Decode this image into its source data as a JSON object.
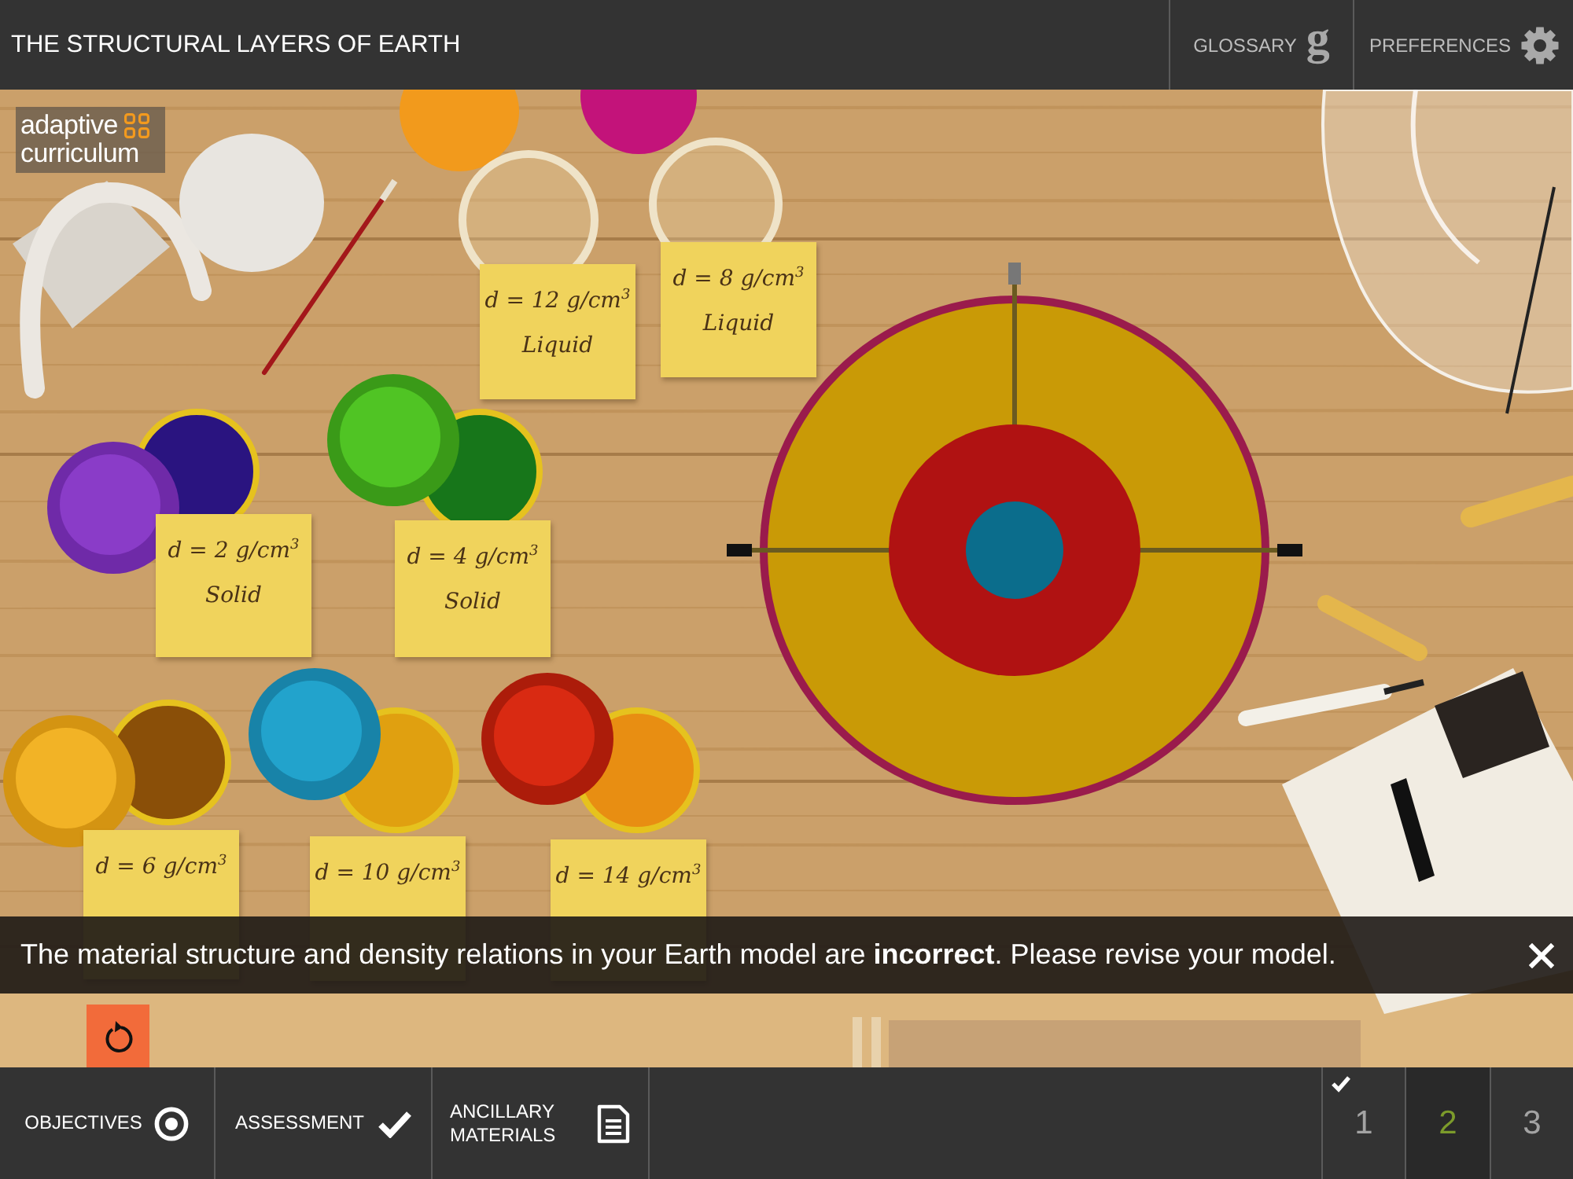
{
  "header": {
    "title": "THE STRUCTURAL LAYERS OF EARTH",
    "buttons": [
      {
        "kind": "glossary",
        "label": "GLOSSARY",
        "glyph": "g"
      },
      {
        "kind": "settings",
        "label": "PREFERENCES"
      }
    ]
  },
  "logo": {
    "lines": [
      "adaptive",
      "curriculum"
    ]
  },
  "scene": {
    "notes": [
      {
        "density": "d = 12 g/cm$^{3}$",
        "state": "Liquid"
      },
      {
        "density": "d = 8 g/cm$^{3}$",
        "state": "Liquid"
      },
      {
        "density": "d = 2 g/cm$^{3}$",
        "state": "Solid"
      },
      {
        "density": "d = 4 g/cm$^{3}$",
        "state": "Solid"
      },
      {
        "density": "d = 6 g/cm$^{3}$"
      },
      {
        "density": "d = 10 g/cm$^{3}$"
      },
      {
        "density": "d = 14 g/cm$^{3}$"
      }
    ],
    "earth_model": {
      "layers": [
        {
          "color": "#0b6d8c"
        },
        {
          "color": "#b01212"
        },
        {
          "color": "#c99a06"
        },
        {
          "color": "#9a1b4c"
        }
      ]
    }
  },
  "feedback": {
    "message": "The material structure and density relations in your Earth model are **incorrect**. Please revise your model."
  },
  "footer": {
    "sections": [
      {
        "kind": "target",
        "label": "OBJECTIVES"
      },
      {
        "kind": "check",
        "label": "ASSESSMENT"
      },
      {
        "kind": "document",
        "label": "ANCILLARY MATERIALS"
      }
    ],
    "pages": [
      {
        "label": "1",
        "selected": false,
        "completed": true
      },
      {
        "label": "2",
        "selected": true,
        "completed": false
      },
      {
        "label": "3",
        "selected": false,
        "completed": false
      }
    ]
  }
}
